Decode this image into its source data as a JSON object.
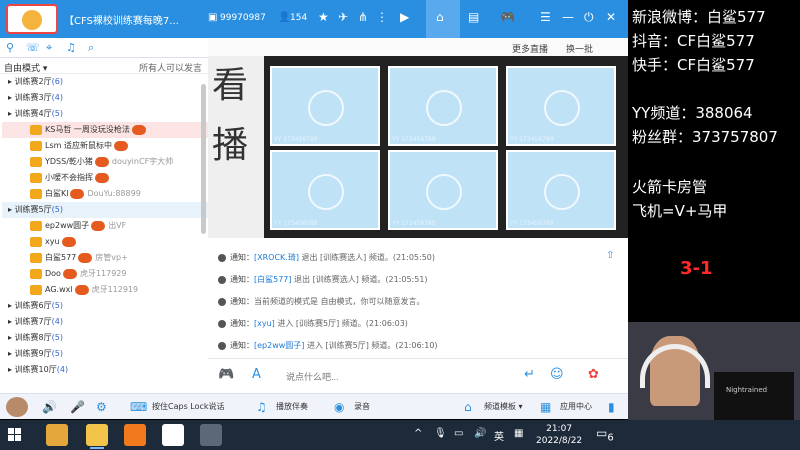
{
  "titlebar": {
    "channel_title": "【CFS裸校训练赛每晚7...",
    "channel_id": "99970987",
    "online_count": "154"
  },
  "left": {
    "mode_label": "自由模式 ▾",
    "mode_desc": "所有人可以发言",
    "tree": [
      {
        "kind": "channel",
        "label": "训练赛2厅",
        "count": "(6)"
      },
      {
        "kind": "channel",
        "label": "训练赛3厅",
        "count": "(4)"
      },
      {
        "kind": "channel",
        "label": "训练赛4厅",
        "count": "(5)"
      },
      {
        "kind": "user",
        "label": "KS马哲 一周没玩没枪法",
        "extra": "",
        "selected": true
      },
      {
        "kind": "user",
        "label": "Lsm 适应新鼠标中",
        "extra": ""
      },
      {
        "kind": "user",
        "label": "YDSS/乾小猪",
        "extra": "douyinCF宇大帅"
      },
      {
        "kind": "user",
        "label": "小嗳不会指挥",
        "extra": ""
      },
      {
        "kind": "user",
        "label": "白鲨Kl",
        "extra": "DouYu:88899"
      },
      {
        "kind": "channel",
        "label": "训练赛5厅",
        "count": "(5)",
        "highlight": true
      },
      {
        "kind": "user",
        "label": "ep2ww圆子",
        "extra": "出VF"
      },
      {
        "kind": "user",
        "label": "xyu",
        "extra": ""
      },
      {
        "kind": "user",
        "label": "白鲨577",
        "extra": "房管vp+"
      },
      {
        "kind": "user",
        "label": "Doo",
        "extra": "虎牙117929"
      },
      {
        "kind": "user",
        "label": "AG.wxl",
        "extra": "虎牙112919"
      },
      {
        "kind": "channel",
        "label": "训练赛6厅",
        "count": "(5)"
      },
      {
        "kind": "channel",
        "label": "训练赛7厅",
        "count": "(4)"
      },
      {
        "kind": "channel",
        "label": "训练赛8厅",
        "count": "(5)"
      },
      {
        "kind": "channel",
        "label": "训练赛9厅",
        "count": "(5)"
      },
      {
        "kind": "channel",
        "label": "训练赛10厅",
        "count": "(4)"
      }
    ]
  },
  "video": {
    "more_live": "更多直播",
    "refresh": "换一批",
    "poster_text": "看播"
  },
  "chat": [
    {
      "label": "通知：",
      "name": "[XROCK.琦]",
      "text": " 退出 [训练赛选人] 频道。(21:05:50)"
    },
    {
      "label": "通知：",
      "name": "[白鲨577]",
      "text": " 退出 [训练赛选人] 频道。(21:05:51)"
    },
    {
      "label": "通知：",
      "name": "",
      "text": "当前频道的模式是 自由模式，你可以随意发言。"
    },
    {
      "label": "通知：",
      "name": "[xyu]",
      "text": " 进入 [训练赛5厅] 频道。(21:06:03)"
    },
    {
      "label": "通知：",
      "name": "[ep2ww圆子]",
      "text": " 进入 [训练赛5厅] 频道。(21:06:10)"
    }
  ],
  "input": {
    "placeholder": "说点什么吧..."
  },
  "apptoolbar": {
    "caps_lock_talk": "按住Caps Lock说话",
    "play_music": "播放伴奏",
    "record": "录音",
    "channel_template": "频道模板 ▾",
    "app_center": "应用中心"
  },
  "overlay": {
    "lines": [
      "新浪微博：白鲨577",
      "抖音：CF白鲨577",
      "快手：CF白鲨577",
      "YY频道：388064",
      "粉丝群：373757807",
      "火箭卡房管",
      "飞机=V+马甲"
    ],
    "score": "3-1",
    "shirt_text": "Nightrained"
  },
  "taskbar": {
    "ime": "英",
    "time": "21:07",
    "date": "2022/8/22",
    "notification_count": "6"
  },
  "colors": {
    "accent": "#2a8fe0",
    "score": "#ff2a2a"
  }
}
